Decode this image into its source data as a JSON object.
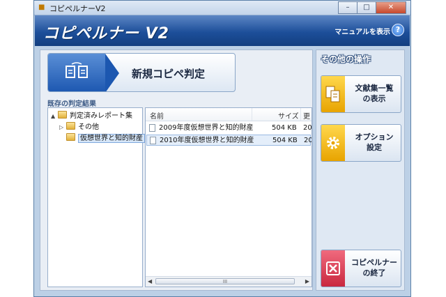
{
  "window": {
    "title": "コピペルナーV2"
  },
  "header": {
    "logo": "コピペルナー V2",
    "manual_label": "マニュアルを表示",
    "help_glyph": "?"
  },
  "main": {
    "new_check_label": "新規コピペ判定",
    "existing_results_label": "既存の判定結果"
  },
  "tree": {
    "items": [
      {
        "label": "判定済みレポート集",
        "expander": "▲"
      },
      {
        "label": "その他",
        "expander": "▷"
      },
      {
        "label": "仮想世界と知的財産",
        "expander": ""
      }
    ]
  },
  "list": {
    "columns": [
      "名前",
      "サイズ",
      "更"
    ],
    "rows": [
      {
        "name": "2009年度仮想世界と知的財産",
        "size": "504 KB",
        "date": "20"
      },
      {
        "name": "2010年度仮想世界と知的財産",
        "size": "504 KB",
        "date": "20"
      }
    ],
    "scroll_grip": "III"
  },
  "side": {
    "title": "その他の操作",
    "buttons": [
      {
        "line1": "文献集一覧",
        "line2": "の表示",
        "icon": "documents-icon"
      },
      {
        "line1": "オプション",
        "line2": "設定",
        "icon": "gear-icon"
      },
      {
        "line1": "コピペルナー",
        "line2": "の終了",
        "icon": "exit-icon"
      }
    ]
  },
  "colors": {
    "header_blue": "#1d4f9a",
    "accent_yellow": "#e8a400",
    "exit_red": "#c9283f"
  }
}
